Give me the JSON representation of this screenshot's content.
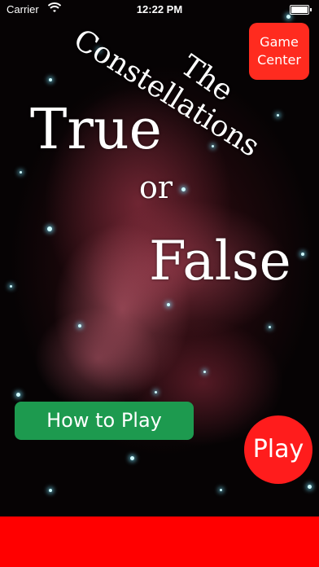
{
  "status_bar": {
    "carrier": "Carrier",
    "time": "12:22 PM"
  },
  "title": {
    "the": "The",
    "constellations": "Constellations",
    "true": "True",
    "or": "or",
    "false": "False"
  },
  "buttons": {
    "game_center": "Game Center",
    "how_to_play": "How to Play",
    "play": "Play"
  },
  "colors": {
    "game_center": "#ff2b1f",
    "how_to_play": "#1d9a4f",
    "play": "#ff1c1c",
    "bottom_bar": "#ff0000"
  },
  "icons": [
    "wifi-icon",
    "battery-icon"
  ]
}
